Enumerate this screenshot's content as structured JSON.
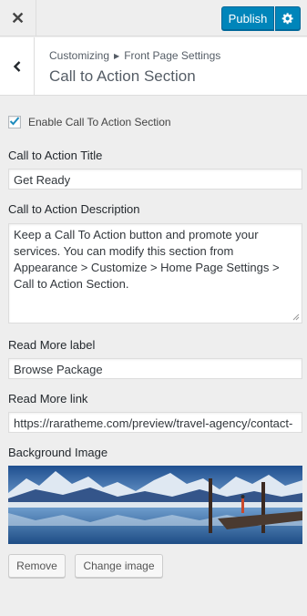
{
  "header": {
    "close_icon": "close-icon",
    "publish_label": "Publish",
    "gear_icon": "gear-icon",
    "accent": "#0085ba"
  },
  "section": {
    "breadcrumb_parent": "Customizing",
    "breadcrumb_current": "Front Page Settings",
    "title": "Call to Action Section"
  },
  "controls": {
    "enable_label": "Enable Call To Action Section",
    "enable_checked": true,
    "title_label": "Call to Action Title",
    "title_value": "Get Ready",
    "description_label": "Call to Action Description",
    "description_value": "Keep a Call To Action button and promote your services. You can modify this section from Appearance > Customize > Home Page Settings > Call to Action Section.",
    "read_more_label_label": "Read More label",
    "read_more_label_value": "Browse Package",
    "read_more_link_label": "Read More link",
    "read_more_link_value": "https://raratheme.com/preview/travel-agency/contact-",
    "background_label": "Background Image",
    "remove_label": "Remove",
    "change_image_label": "Change image"
  }
}
